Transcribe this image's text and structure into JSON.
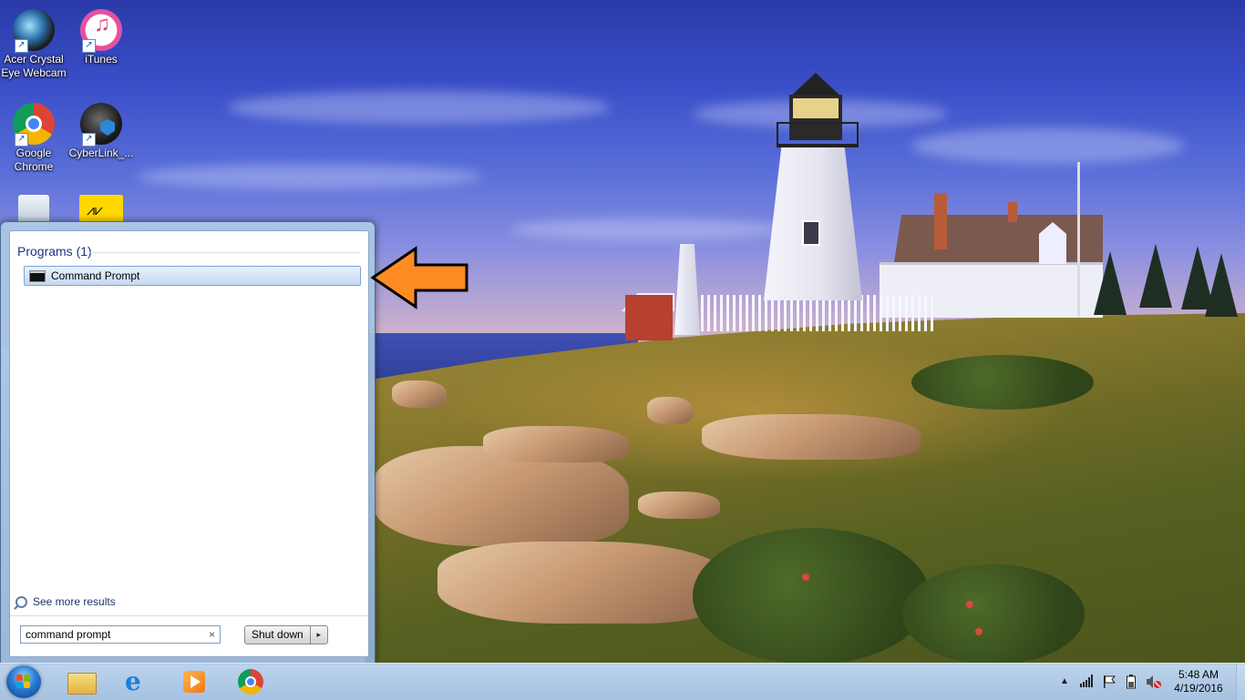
{
  "desktop": {
    "icons": [
      {
        "label": "Acer Crystal Eye Webcam",
        "icon": "webcam-icon"
      },
      {
        "label": "iTunes",
        "icon": "itunes-icon"
      },
      {
        "label": "Google Chrome",
        "icon": "chrome-icon"
      },
      {
        "label": "CyberLink_...",
        "icon": "cyberlink-icon"
      },
      {
        "label": "",
        "icon": "recycle-bin-icon"
      },
      {
        "label": "",
        "icon": "audio-app-icon"
      }
    ]
  },
  "start_menu": {
    "group_header": "Programs (1)",
    "results": [
      {
        "label": "Command Prompt",
        "icon": "cmd-icon"
      }
    ],
    "see_more": "See more results",
    "search_value": "command prompt",
    "shutdown_label": "Shut down",
    "clear_glyph": "×",
    "arrow_glyph": "▸"
  },
  "annotation": {
    "arrow_fill": "#ff8c22",
    "arrow_stroke": "#000000"
  },
  "taskbar": {
    "pinned": [
      "windows-explorer-icon",
      "internet-explorer-icon",
      "media-player-icon",
      "chrome-icon"
    ],
    "tray_icons": [
      "show-hidden-icons-icon",
      "network-signal-icon",
      "action-center-flag-icon",
      "battery-icon",
      "volume-muted-icon"
    ],
    "time": "5:48 AM",
    "date": "4/19/2016"
  },
  "colors": {
    "accent": "#1e3287",
    "selection_border": "#7da2ce"
  }
}
